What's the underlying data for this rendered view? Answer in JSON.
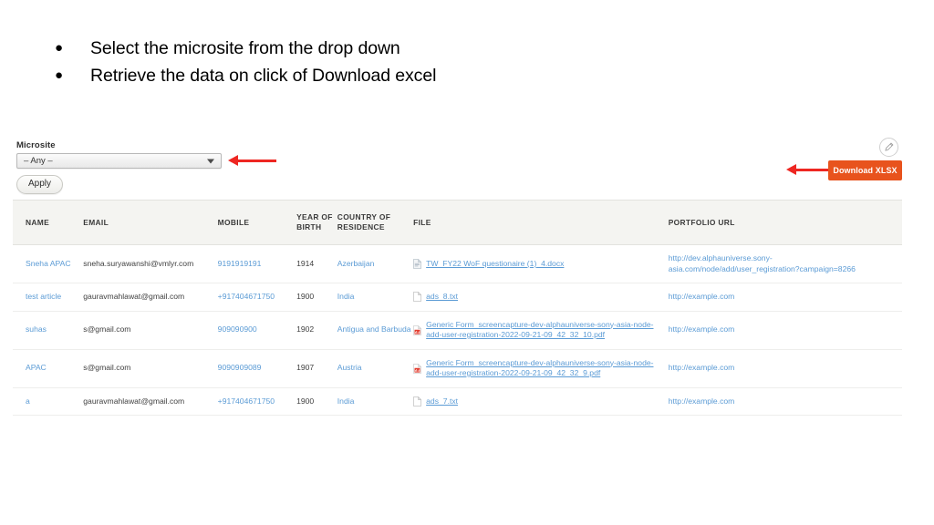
{
  "slide": {
    "bullets": [
      "Select the microsite from the drop down",
      "Retrieve the data on click of Download excel"
    ],
    "bullet_glyph": "●"
  },
  "filter": {
    "label": "Microsite",
    "select_value": "– Any –",
    "apply_label": "Apply"
  },
  "actions": {
    "download_label": "Download XLSX",
    "download_color": "#e8531d",
    "pencil_icon": "pencil-icon"
  },
  "table": {
    "headers": {
      "name": "NAME",
      "email": "EMAIL",
      "mobile": "MOBILE",
      "year_of_birth": "YEAR OF BIRTH",
      "country_of_residence": "COUNTRY OF RESIDENCE",
      "file": "FILE",
      "portfolio_url": "PORTFOLIO URL"
    },
    "link_color": "#5b9bd5",
    "rows": [
      {
        "name": "Sneha APAC",
        "email": "sneha.suryawanshi@vmlyr.com",
        "mobile": "9191919191",
        "year_of_birth": "1914",
        "country": "Azerbaijan",
        "file": "TW_FY22 WoF questionaire (1)_4.docx",
        "file_type": "docx",
        "url": "http://dev.alphauniverse.sony-asia.com/node/add/user_registration?campaign=8266"
      },
      {
        "name": "test article",
        "email": "gauravmahlawat@gmail.com",
        "mobile": "+917404671750",
        "year_of_birth": "1900",
        "country": "India",
        "file": "ads_8.txt",
        "file_type": "txt",
        "url": "http://example.com"
      },
      {
        "name": "suhas",
        "email": "s@gmail.com",
        "mobile": "909090900",
        "year_of_birth": "1902",
        "country": "Antigua and Barbuda",
        "file": "Generic Form_screencapture-dev-alphauniverse-sony-asia-node-add-user-registration-2022-09-21-09_42_32_10.pdf",
        "file_type": "pdf",
        "url": "http://example.com"
      },
      {
        "name": "APAC",
        "email": "s@gmail.com",
        "mobile": "9090909089",
        "year_of_birth": "1907",
        "country": "Austria",
        "file": "Generic Form_screencapture-dev-alphauniverse-sony-asia-node-add-user-registration-2022-09-21-09_42_32_9.pdf",
        "file_type": "pdf",
        "url": "http://example.com"
      },
      {
        "name": "a",
        "email": "gauravmahlawat@gmail.com",
        "mobile": "+917404671750",
        "year_of_birth": "1900",
        "country": "India",
        "file": "ads_7.txt",
        "file_type": "txt",
        "url": "http://example.com"
      }
    ]
  }
}
